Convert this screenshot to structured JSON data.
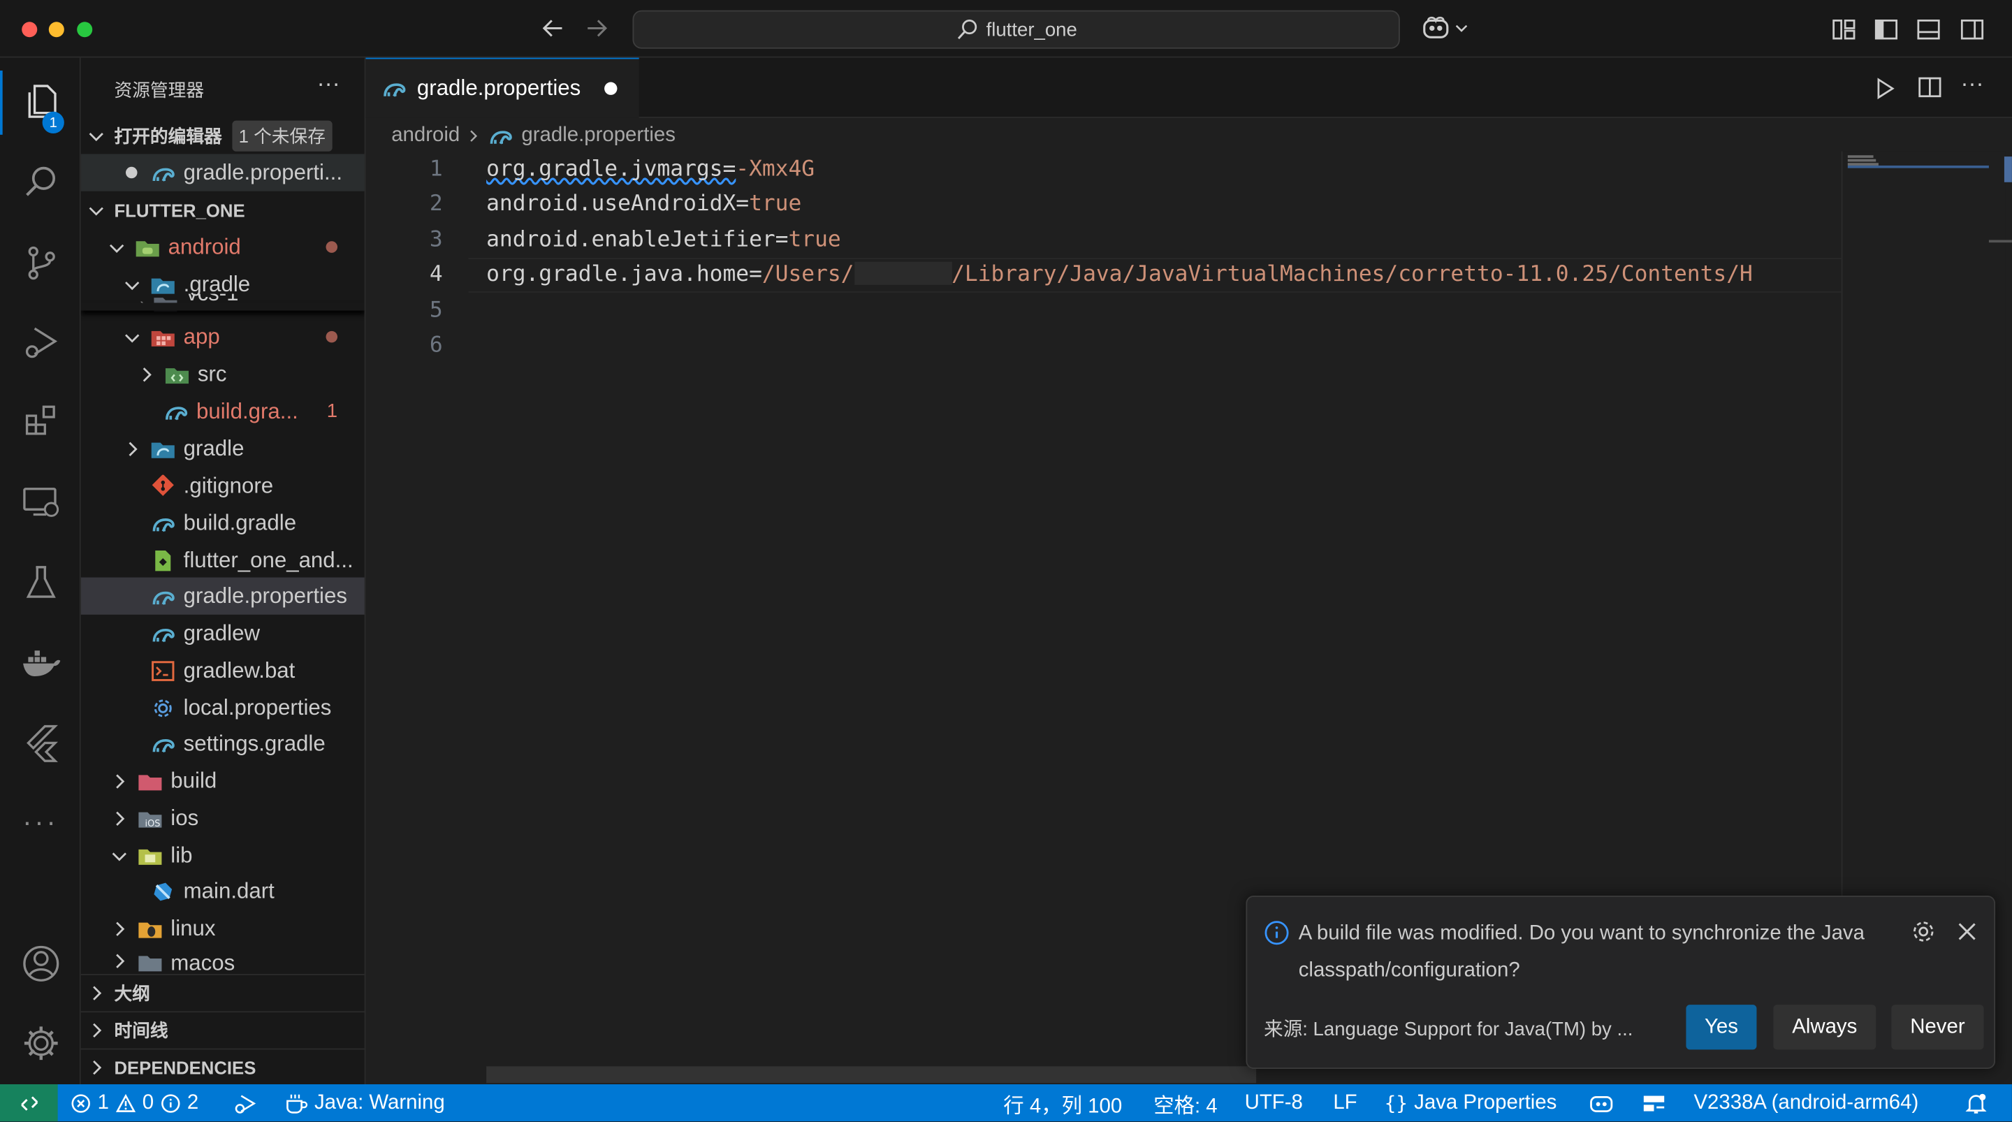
{
  "window": {
    "title": "flutter_one"
  },
  "activity": {
    "explorer_badge": "1"
  },
  "sidebar": {
    "title": "资源管理器",
    "more": "···",
    "open_editors": {
      "label": "打开的编辑器",
      "badge": "1 个未保存",
      "file": "gradle.properti..."
    },
    "workspace": "FLUTTER_ONE",
    "tree": [
      {
        "label": "android",
        "badge": "",
        "git": "modified"
      },
      {
        "label": ".gradle",
        "badge": ""
      },
      {
        "label": "vcs-1",
        "badge": ""
      },
      {
        "label": "app",
        "badge": ""
      },
      {
        "label": "src",
        "badge": ""
      },
      {
        "label": "build.gra...",
        "badge": "1"
      },
      {
        "label": "gradle",
        "badge": ""
      },
      {
        "label": ".gitignore",
        "badge": ""
      },
      {
        "label": "build.gradle",
        "badge": ""
      },
      {
        "label": "flutter_one_and...",
        "badge": ""
      },
      {
        "label": "gradle.properties",
        "badge": ""
      },
      {
        "label": "gradlew",
        "badge": ""
      },
      {
        "label": "gradlew.bat",
        "badge": ""
      },
      {
        "label": "local.properties",
        "badge": ""
      },
      {
        "label": "settings.gradle",
        "badge": ""
      },
      {
        "label": "build",
        "badge": ""
      },
      {
        "label": "ios",
        "badge": ""
      },
      {
        "label": "lib",
        "badge": ""
      },
      {
        "label": "main.dart",
        "badge": ""
      },
      {
        "label": "linux",
        "badge": ""
      },
      {
        "label": "macos",
        "badge": ""
      }
    ],
    "outline": "大纲",
    "timeline": "时间线",
    "dependencies": "DEPENDENCIES"
  },
  "editor": {
    "tab_label": "gradle.properties",
    "breadcrumb": [
      "android",
      "gradle.properties"
    ],
    "lines": [
      {
        "num": "1",
        "key": "org.gradle.jvmargs=",
        "value": "-Xmx4G"
      },
      {
        "num": "2",
        "key": "android.useAndroidX=",
        "value": "true"
      },
      {
        "num": "3",
        "key": "android.enableJetifier=",
        "value": "true"
      },
      {
        "num": "4",
        "key": "org.gradle.java.home=",
        "value": "/Users/",
        "value2": "/Library/Java/JavaVirtualMachines/corretto-11.0.25/Contents/H"
      },
      {
        "num": "5",
        "key": "",
        "value": ""
      },
      {
        "num": "6",
        "key": "",
        "value": ""
      }
    ]
  },
  "notification": {
    "message": "A build file was modified. Do you want to synchronize the Java classpath/configuration?",
    "source": "来源: Language Support for Java(TM) by ...",
    "buttons": {
      "yes": "Yes",
      "always": "Always",
      "never": "Never"
    }
  },
  "statusbar": {
    "errors": "1",
    "warnings": "0",
    "infos": "2",
    "java": "Java: Warning",
    "position": "行 4，列 100",
    "spaces": "空格: 4",
    "encoding": "UTF-8",
    "eol": "LF",
    "language": "Java Properties",
    "device": "V2338A (android-arm64)"
  },
  "colors": {
    "accent": "#0078d4",
    "status_bg": "#0078d4",
    "modified": "#e27a6b",
    "yes_button": "#0e639c",
    "button": "#313131"
  }
}
